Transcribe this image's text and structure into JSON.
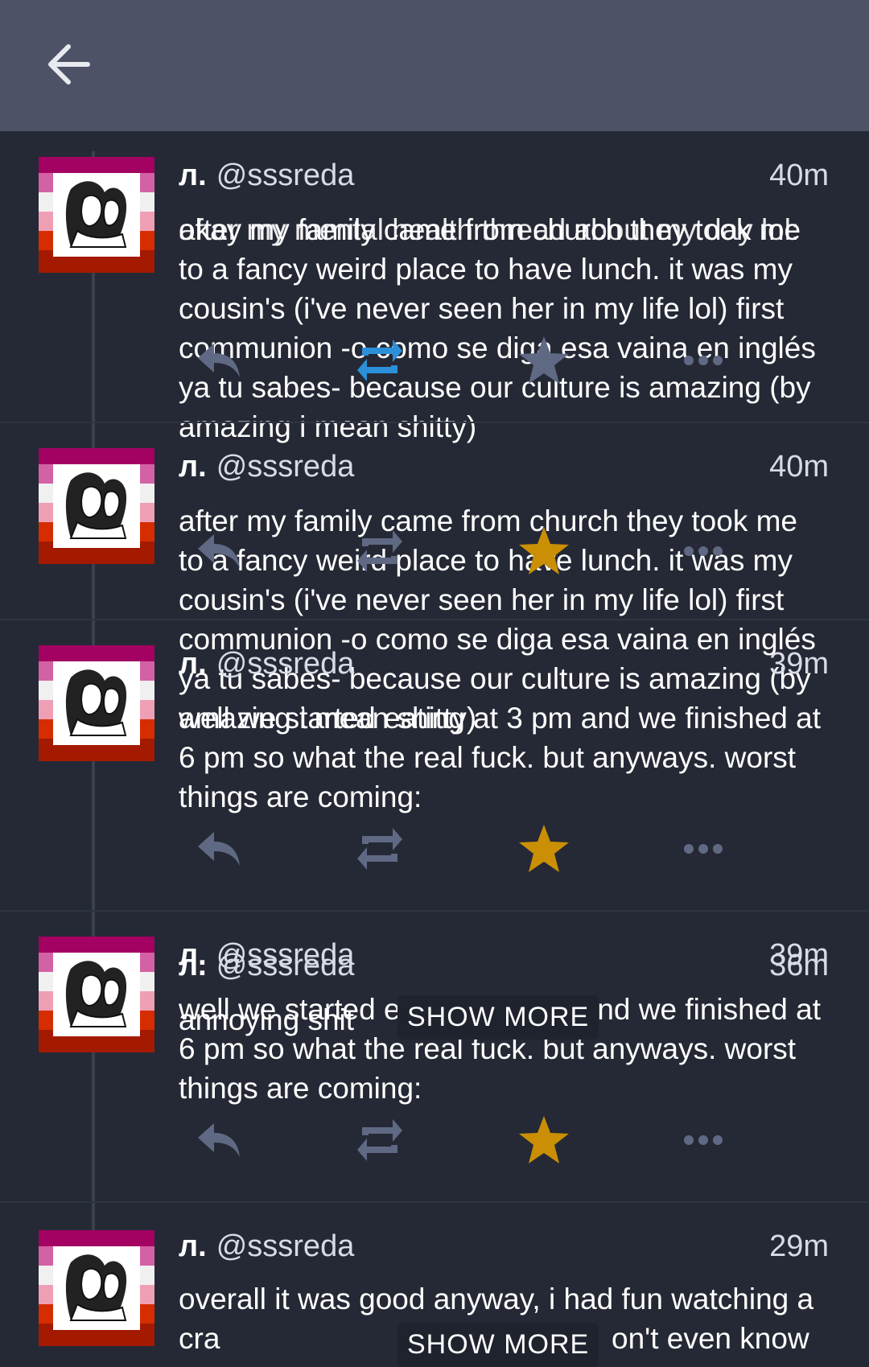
{
  "header": {
    "back_icon": "arrow-left-icon"
  },
  "colors": {
    "topbar": "#4d5266",
    "background": "#252935",
    "accent_blue": "#2b90d9",
    "favourite": "#ca8f04",
    "icon_muted": "#606984"
  },
  "account": {
    "display_name": "л.",
    "handle": "@sssreda"
  },
  "statuses": [
    {
      "time": "40m",
      "content": "okay my family came from church they took me to a fancy weird place to have lunch. it was my cousin's (i've never seen her in my life lol) first communion -o como se diga esa vaina en inglés ya tu sabes- because our culture is amazing (by amazing i mean shitty)"
    },
    {
      "time": "40m",
      "content": "after my family came from church they took me to a fancy weird place to have lunch. it was my cousin's (i've never seen her in my life lol) first communion -o como se diga esa vaina en inglés ya tu sabes- because our culture is amazing (by amazing i mean shitty)"
    },
    {
      "time": "39m",
      "content": "well we started eating at 3 pm and we finished at 6 pm so what the real fuck. but anyways. worst things are coming:"
    },
    {
      "time": "39m",
      "content": "well we started eating at 3 pm and we finished at 6 pm so what the real fuck. but anyways. worst things are coming:"
    },
    {
      "time": "36m",
      "content": "annoying shit"
    },
    {
      "time": "29m",
      "content": "overall it was good anyway, i had fun watching a cra"
    }
  ],
  "ghost_header": {
    "time": "40m",
    "text": "after my mental health thread about my day lol:"
  },
  "show_more_label": "SHOW MORE",
  "tail_fragment": "on't even know"
}
